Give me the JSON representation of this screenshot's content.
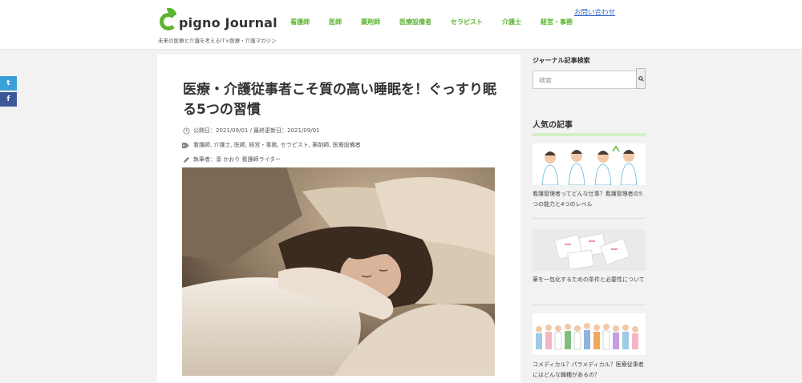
{
  "header": {
    "logo_text": "pigno Journal",
    "tagline": "未来の医療と介護を考えるIT×医療・介護マガジン",
    "contact": "お問い合わせ",
    "nav": [
      "看護師",
      "医師",
      "薬剤師",
      "医療設備者",
      "セラピスト",
      "介護士",
      "経営・事務"
    ]
  },
  "social": {
    "twitter_glyph": "t",
    "facebook_glyph": "f"
  },
  "article": {
    "title": "医療・介護従事者こそ質の高い睡眠を！ぐっすり眠る5つの習慣",
    "date": "公開日：2021/09/01 / 最終更新日：2021/09/01",
    "tags": "看護師, 介護士, 医師, 経営・事務, セラピスト, 薬剤師, 医療設備者",
    "author": "執筆者：湊 かおり 看護師ライター"
  },
  "sidebar": {
    "search_title": "ジャーナル記事検索",
    "search_placeholder": "検索",
    "popular_title": "人気の記事",
    "cards": [
      {
        "text": "看護管理者ってどんな仕事？看護管理者の5つの能力と4つのレベル"
      },
      {
        "text": "薬を一包化するための条件と必要性について"
      },
      {
        "text": "コメディカル？パラメディカル？医療従事者にはどんな職種があるの？"
      }
    ]
  },
  "colors": {
    "brand_green": "#5cb531",
    "link_blue": "#3366cc"
  }
}
